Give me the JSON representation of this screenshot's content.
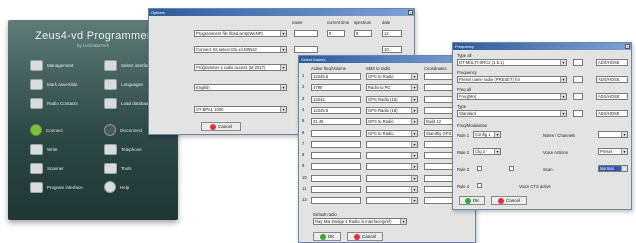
{
  "main_window": {
    "title": "Zeus4-vd Programmer",
    "subtitle": "by LeGlaBaTerb",
    "buttons": [
      {
        "label": "Management",
        "icon": "monitor-icon"
      },
      {
        "label": "Select interface",
        "icon": "phone-icon"
      },
      {
        "label": "Mark assemble",
        "icon": "book-icon"
      },
      {
        "label": "Languages",
        "icon": "book-icon"
      },
      {
        "label": "Radio Contacts",
        "icon": "radio-icon"
      },
      {
        "label": "Load databases",
        "icon": "disk-icon"
      },
      {
        "label": "Connect",
        "icon": "arrow-left-icon"
      },
      {
        "label": "Disconnect",
        "icon": "arrow-right-icon"
      },
      {
        "label": "Write",
        "icon": "pencil-icon"
      },
      {
        "label": "Telephone",
        "icon": "wrench-icon"
      },
      {
        "label": "Scanner",
        "icon": "printer-icon"
      },
      {
        "label": "Tools",
        "icon": "disk-icon"
      },
      {
        "label": "Program interface",
        "icon": "satellite-icon"
      },
      {
        "label": "Help",
        "icon": "question-icon"
      }
    ]
  },
  "dialog1": {
    "title": "Options",
    "headers": [
      "name",
      "current time",
      "spectrum",
      "date"
    ],
    "rows": [
      {
        "select": "Programmers file bbsd.wntp(WeNP)",
        "a": "",
        "b": "8",
        "c": "8",
        "d": "12"
      },
      {
        "select": "Connect rts.setvar.Gsi.xd.BrtNs3",
        "a": "",
        "b": "",
        "c": "",
        "d": "10"
      },
      {
        "select": "Programmer 4 radio access (M 2017)",
        "a": "",
        "b": "",
        "c": "",
        "d": ""
      },
      {
        "select": "English",
        "a": "",
        "b": "",
        "c": "",
        "d": ""
      },
      {
        "select": "SY-BPA1 1000",
        "a": "",
        "b": "",
        "c": "",
        "d": ""
      }
    ],
    "cancel_label": "Cancel"
  },
  "dialog2": {
    "title": "Select frames",
    "col_headers": [
      "Active freq/Volume",
      "SMS to radio",
      "Coordinates"
    ],
    "rows": [
      {
        "n": "1",
        "a": "12345.6",
        "b": "GPS to Radio",
        "c": ""
      },
      {
        "n": "2",
        "a": "4790",
        "b": "Radio to PC",
        "c": ""
      },
      {
        "n": "3",
        "a": "13342",
        "b": "GPS Radio (15)",
        "c": ""
      },
      {
        "n": "4",
        "a": "12345.6",
        "b": "GPS Radio (18)",
        "c": ""
      },
      {
        "n": "5",
        "a": "31.45",
        "b": "GPS to Radio",
        "c": "Build 12"
      },
      {
        "n": "6",
        "a": "",
        "b": "GPS to Radio",
        "c": "Standby GPS"
      },
      {
        "n": "7",
        "a": "",
        "b": "",
        "c": ""
      },
      {
        "n": "8",
        "a": "",
        "b": "",
        "c": ""
      },
      {
        "n": "9",
        "a": "",
        "b": "",
        "c": ""
      },
      {
        "n": "10",
        "a": "",
        "b": "",
        "c": ""
      },
      {
        "n": "11",
        "a": "",
        "b": "",
        "c": ""
      },
      {
        "n": "12",
        "a": "",
        "b": "",
        "c": ""
      }
    ],
    "bottom_label": "Default radio",
    "bottom_select": "Ray Mar Bridge 4 Radio in Interface(pref)",
    "ok_label": "OK",
    "cancel_label": "Cancel"
  },
  "dialog3": {
    "title": "Frequency",
    "sections": [
      "Type all",
      "Frequency",
      "Freq all",
      "Type"
    ],
    "rows": [
      {
        "select": "DT-MULTI-SRC2 (1.5.1)",
        "n": "",
        "t": "ADS/HOSE"
      },
      {
        "select": "Preset name radio (PRESET) for",
        "n": "",
        "t": "ADS/HOSE"
      },
      {
        "select": "Freq(Mo)",
        "n": "",
        "t": "ADS/HOSE"
      },
      {
        "select": "Standard",
        "n": "",
        "t": "ADS/HOSE"
      }
    ],
    "options_label": "Freq/Modulation",
    "grid": [
      {
        "label": "Rule 1",
        "sel": "Config 1",
        "right_label": "Notes / Channels",
        "right_val": ""
      },
      {
        "label": "Rule 2",
        "sel": "Cfg 2",
        "right_label": "Voice Actions",
        "right_val": "Preset"
      },
      {
        "label": "Rule 3",
        "sel": "",
        "right_label": "Scan",
        "right_val": "Normal"
      },
      {
        "label": "Rule 4",
        "sel": "",
        "right_label": "Voice CTS active",
        "right_val": ""
      }
    ],
    "ok_label": "OK",
    "cancel_label": "Cancel"
  },
  "colors": {
    "panel": "#2e4947",
    "titlebar": "#2e5a9a",
    "highlight": "#2e5aac"
  }
}
